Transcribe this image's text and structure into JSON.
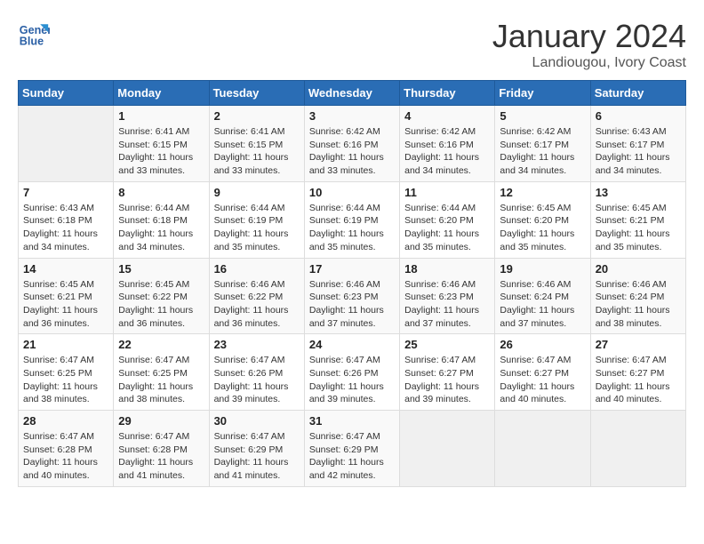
{
  "header": {
    "logo_line1": "General",
    "logo_line2": "Blue",
    "month_title": "January 2024",
    "location": "Landiougou, Ivory Coast"
  },
  "weekdays": [
    "Sunday",
    "Monday",
    "Tuesday",
    "Wednesday",
    "Thursday",
    "Friday",
    "Saturday"
  ],
  "weeks": [
    [
      {
        "day": "",
        "sunrise": "",
        "sunset": "",
        "daylight": ""
      },
      {
        "day": "1",
        "sunrise": "Sunrise: 6:41 AM",
        "sunset": "Sunset: 6:15 PM",
        "daylight": "Daylight: 11 hours and 33 minutes."
      },
      {
        "day": "2",
        "sunrise": "Sunrise: 6:41 AM",
        "sunset": "Sunset: 6:15 PM",
        "daylight": "Daylight: 11 hours and 33 minutes."
      },
      {
        "day": "3",
        "sunrise": "Sunrise: 6:42 AM",
        "sunset": "Sunset: 6:16 PM",
        "daylight": "Daylight: 11 hours and 33 minutes."
      },
      {
        "day": "4",
        "sunrise": "Sunrise: 6:42 AM",
        "sunset": "Sunset: 6:16 PM",
        "daylight": "Daylight: 11 hours and 34 minutes."
      },
      {
        "day": "5",
        "sunrise": "Sunrise: 6:42 AM",
        "sunset": "Sunset: 6:17 PM",
        "daylight": "Daylight: 11 hours and 34 minutes."
      },
      {
        "day": "6",
        "sunrise": "Sunrise: 6:43 AM",
        "sunset": "Sunset: 6:17 PM",
        "daylight": "Daylight: 11 hours and 34 minutes."
      }
    ],
    [
      {
        "day": "7",
        "sunrise": "Sunrise: 6:43 AM",
        "sunset": "Sunset: 6:18 PM",
        "daylight": "Daylight: 11 hours and 34 minutes."
      },
      {
        "day": "8",
        "sunrise": "Sunrise: 6:44 AM",
        "sunset": "Sunset: 6:18 PM",
        "daylight": "Daylight: 11 hours and 34 minutes."
      },
      {
        "day": "9",
        "sunrise": "Sunrise: 6:44 AM",
        "sunset": "Sunset: 6:19 PM",
        "daylight": "Daylight: 11 hours and 35 minutes."
      },
      {
        "day": "10",
        "sunrise": "Sunrise: 6:44 AM",
        "sunset": "Sunset: 6:19 PM",
        "daylight": "Daylight: 11 hours and 35 minutes."
      },
      {
        "day": "11",
        "sunrise": "Sunrise: 6:44 AM",
        "sunset": "Sunset: 6:20 PM",
        "daylight": "Daylight: 11 hours and 35 minutes."
      },
      {
        "day": "12",
        "sunrise": "Sunrise: 6:45 AM",
        "sunset": "Sunset: 6:20 PM",
        "daylight": "Daylight: 11 hours and 35 minutes."
      },
      {
        "day": "13",
        "sunrise": "Sunrise: 6:45 AM",
        "sunset": "Sunset: 6:21 PM",
        "daylight": "Daylight: 11 hours and 35 minutes."
      }
    ],
    [
      {
        "day": "14",
        "sunrise": "Sunrise: 6:45 AM",
        "sunset": "Sunset: 6:21 PM",
        "daylight": "Daylight: 11 hours and 36 minutes."
      },
      {
        "day": "15",
        "sunrise": "Sunrise: 6:45 AM",
        "sunset": "Sunset: 6:22 PM",
        "daylight": "Daylight: 11 hours and 36 minutes."
      },
      {
        "day": "16",
        "sunrise": "Sunrise: 6:46 AM",
        "sunset": "Sunset: 6:22 PM",
        "daylight": "Daylight: 11 hours and 36 minutes."
      },
      {
        "day": "17",
        "sunrise": "Sunrise: 6:46 AM",
        "sunset": "Sunset: 6:23 PM",
        "daylight": "Daylight: 11 hours and 37 minutes."
      },
      {
        "day": "18",
        "sunrise": "Sunrise: 6:46 AM",
        "sunset": "Sunset: 6:23 PM",
        "daylight": "Daylight: 11 hours and 37 minutes."
      },
      {
        "day": "19",
        "sunrise": "Sunrise: 6:46 AM",
        "sunset": "Sunset: 6:24 PM",
        "daylight": "Daylight: 11 hours and 37 minutes."
      },
      {
        "day": "20",
        "sunrise": "Sunrise: 6:46 AM",
        "sunset": "Sunset: 6:24 PM",
        "daylight": "Daylight: 11 hours and 38 minutes."
      }
    ],
    [
      {
        "day": "21",
        "sunrise": "Sunrise: 6:47 AM",
        "sunset": "Sunset: 6:25 PM",
        "daylight": "Daylight: 11 hours and 38 minutes."
      },
      {
        "day": "22",
        "sunrise": "Sunrise: 6:47 AM",
        "sunset": "Sunset: 6:25 PM",
        "daylight": "Daylight: 11 hours and 38 minutes."
      },
      {
        "day": "23",
        "sunrise": "Sunrise: 6:47 AM",
        "sunset": "Sunset: 6:26 PM",
        "daylight": "Daylight: 11 hours and 39 minutes."
      },
      {
        "day": "24",
        "sunrise": "Sunrise: 6:47 AM",
        "sunset": "Sunset: 6:26 PM",
        "daylight": "Daylight: 11 hours and 39 minutes."
      },
      {
        "day": "25",
        "sunrise": "Sunrise: 6:47 AM",
        "sunset": "Sunset: 6:27 PM",
        "daylight": "Daylight: 11 hours and 39 minutes."
      },
      {
        "day": "26",
        "sunrise": "Sunrise: 6:47 AM",
        "sunset": "Sunset: 6:27 PM",
        "daylight": "Daylight: 11 hours and 40 minutes."
      },
      {
        "day": "27",
        "sunrise": "Sunrise: 6:47 AM",
        "sunset": "Sunset: 6:27 PM",
        "daylight": "Daylight: 11 hours and 40 minutes."
      }
    ],
    [
      {
        "day": "28",
        "sunrise": "Sunrise: 6:47 AM",
        "sunset": "Sunset: 6:28 PM",
        "daylight": "Daylight: 11 hours and 40 minutes."
      },
      {
        "day": "29",
        "sunrise": "Sunrise: 6:47 AM",
        "sunset": "Sunset: 6:28 PM",
        "daylight": "Daylight: 11 hours and 41 minutes."
      },
      {
        "day": "30",
        "sunrise": "Sunrise: 6:47 AM",
        "sunset": "Sunset: 6:29 PM",
        "daylight": "Daylight: 11 hours and 41 minutes."
      },
      {
        "day": "31",
        "sunrise": "Sunrise: 6:47 AM",
        "sunset": "Sunset: 6:29 PM",
        "daylight": "Daylight: 11 hours and 42 minutes."
      },
      {
        "day": "",
        "sunrise": "",
        "sunset": "",
        "daylight": ""
      },
      {
        "day": "",
        "sunrise": "",
        "sunset": "",
        "daylight": ""
      },
      {
        "day": "",
        "sunrise": "",
        "sunset": "",
        "daylight": ""
      }
    ]
  ]
}
